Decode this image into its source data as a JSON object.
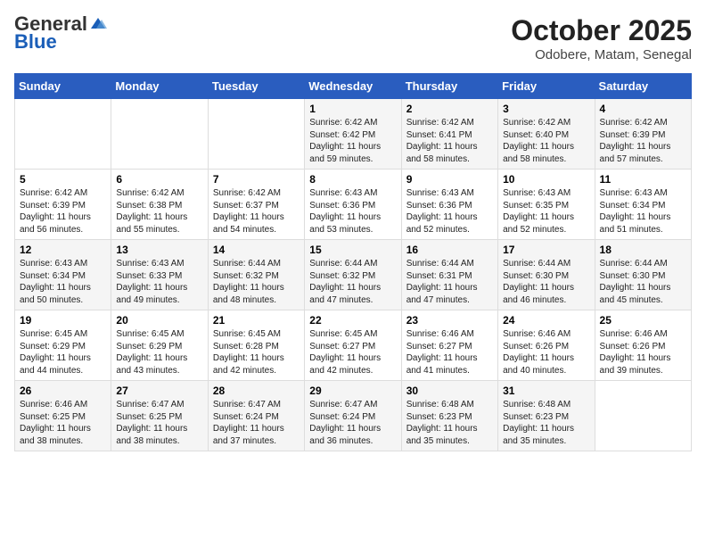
{
  "header": {
    "logo_general": "General",
    "logo_blue": "Blue",
    "month_title": "October 2025",
    "subtitle": "Odobere, Matam, Senegal"
  },
  "days_of_week": [
    "Sunday",
    "Monday",
    "Tuesday",
    "Wednesday",
    "Thursday",
    "Friday",
    "Saturday"
  ],
  "weeks": [
    [
      {
        "day": "",
        "sunrise": "",
        "sunset": "",
        "daylight": ""
      },
      {
        "day": "",
        "sunrise": "",
        "sunset": "",
        "daylight": ""
      },
      {
        "day": "",
        "sunrise": "",
        "sunset": "",
        "daylight": ""
      },
      {
        "day": "1",
        "sunrise": "Sunrise: 6:42 AM",
        "sunset": "Sunset: 6:42 PM",
        "daylight": "Daylight: 11 hours and 59 minutes."
      },
      {
        "day": "2",
        "sunrise": "Sunrise: 6:42 AM",
        "sunset": "Sunset: 6:41 PM",
        "daylight": "Daylight: 11 hours and 58 minutes."
      },
      {
        "day": "3",
        "sunrise": "Sunrise: 6:42 AM",
        "sunset": "Sunset: 6:40 PM",
        "daylight": "Daylight: 11 hours and 58 minutes."
      },
      {
        "day": "4",
        "sunrise": "Sunrise: 6:42 AM",
        "sunset": "Sunset: 6:39 PM",
        "daylight": "Daylight: 11 hours and 57 minutes."
      }
    ],
    [
      {
        "day": "5",
        "sunrise": "Sunrise: 6:42 AM",
        "sunset": "Sunset: 6:39 PM",
        "daylight": "Daylight: 11 hours and 56 minutes."
      },
      {
        "day": "6",
        "sunrise": "Sunrise: 6:42 AM",
        "sunset": "Sunset: 6:38 PM",
        "daylight": "Daylight: 11 hours and 55 minutes."
      },
      {
        "day": "7",
        "sunrise": "Sunrise: 6:42 AM",
        "sunset": "Sunset: 6:37 PM",
        "daylight": "Daylight: 11 hours and 54 minutes."
      },
      {
        "day": "8",
        "sunrise": "Sunrise: 6:43 AM",
        "sunset": "Sunset: 6:36 PM",
        "daylight": "Daylight: 11 hours and 53 minutes."
      },
      {
        "day": "9",
        "sunrise": "Sunrise: 6:43 AM",
        "sunset": "Sunset: 6:36 PM",
        "daylight": "Daylight: 11 hours and 52 minutes."
      },
      {
        "day": "10",
        "sunrise": "Sunrise: 6:43 AM",
        "sunset": "Sunset: 6:35 PM",
        "daylight": "Daylight: 11 hours and 52 minutes."
      },
      {
        "day": "11",
        "sunrise": "Sunrise: 6:43 AM",
        "sunset": "Sunset: 6:34 PM",
        "daylight": "Daylight: 11 hours and 51 minutes."
      }
    ],
    [
      {
        "day": "12",
        "sunrise": "Sunrise: 6:43 AM",
        "sunset": "Sunset: 6:34 PM",
        "daylight": "Daylight: 11 hours and 50 minutes."
      },
      {
        "day": "13",
        "sunrise": "Sunrise: 6:43 AM",
        "sunset": "Sunset: 6:33 PM",
        "daylight": "Daylight: 11 hours and 49 minutes."
      },
      {
        "day": "14",
        "sunrise": "Sunrise: 6:44 AM",
        "sunset": "Sunset: 6:32 PM",
        "daylight": "Daylight: 11 hours and 48 minutes."
      },
      {
        "day": "15",
        "sunrise": "Sunrise: 6:44 AM",
        "sunset": "Sunset: 6:32 PM",
        "daylight": "Daylight: 11 hours and 47 minutes."
      },
      {
        "day": "16",
        "sunrise": "Sunrise: 6:44 AM",
        "sunset": "Sunset: 6:31 PM",
        "daylight": "Daylight: 11 hours and 47 minutes."
      },
      {
        "day": "17",
        "sunrise": "Sunrise: 6:44 AM",
        "sunset": "Sunset: 6:30 PM",
        "daylight": "Daylight: 11 hours and 46 minutes."
      },
      {
        "day": "18",
        "sunrise": "Sunrise: 6:44 AM",
        "sunset": "Sunset: 6:30 PM",
        "daylight": "Daylight: 11 hours and 45 minutes."
      }
    ],
    [
      {
        "day": "19",
        "sunrise": "Sunrise: 6:45 AM",
        "sunset": "Sunset: 6:29 PM",
        "daylight": "Daylight: 11 hours and 44 minutes."
      },
      {
        "day": "20",
        "sunrise": "Sunrise: 6:45 AM",
        "sunset": "Sunset: 6:29 PM",
        "daylight": "Daylight: 11 hours and 43 minutes."
      },
      {
        "day": "21",
        "sunrise": "Sunrise: 6:45 AM",
        "sunset": "Sunset: 6:28 PM",
        "daylight": "Daylight: 11 hours and 42 minutes."
      },
      {
        "day": "22",
        "sunrise": "Sunrise: 6:45 AM",
        "sunset": "Sunset: 6:27 PM",
        "daylight": "Daylight: 11 hours and 42 minutes."
      },
      {
        "day": "23",
        "sunrise": "Sunrise: 6:46 AM",
        "sunset": "Sunset: 6:27 PM",
        "daylight": "Daylight: 11 hours and 41 minutes."
      },
      {
        "day": "24",
        "sunrise": "Sunrise: 6:46 AM",
        "sunset": "Sunset: 6:26 PM",
        "daylight": "Daylight: 11 hours and 40 minutes."
      },
      {
        "day": "25",
        "sunrise": "Sunrise: 6:46 AM",
        "sunset": "Sunset: 6:26 PM",
        "daylight": "Daylight: 11 hours and 39 minutes."
      }
    ],
    [
      {
        "day": "26",
        "sunrise": "Sunrise: 6:46 AM",
        "sunset": "Sunset: 6:25 PM",
        "daylight": "Daylight: 11 hours and 38 minutes."
      },
      {
        "day": "27",
        "sunrise": "Sunrise: 6:47 AM",
        "sunset": "Sunset: 6:25 PM",
        "daylight": "Daylight: 11 hours and 38 minutes."
      },
      {
        "day": "28",
        "sunrise": "Sunrise: 6:47 AM",
        "sunset": "Sunset: 6:24 PM",
        "daylight": "Daylight: 11 hours and 37 minutes."
      },
      {
        "day": "29",
        "sunrise": "Sunrise: 6:47 AM",
        "sunset": "Sunset: 6:24 PM",
        "daylight": "Daylight: 11 hours and 36 minutes."
      },
      {
        "day": "30",
        "sunrise": "Sunrise: 6:48 AM",
        "sunset": "Sunset: 6:23 PM",
        "daylight": "Daylight: 11 hours and 35 minutes."
      },
      {
        "day": "31",
        "sunrise": "Sunrise: 6:48 AM",
        "sunset": "Sunset: 6:23 PM",
        "daylight": "Daylight: 11 hours and 35 minutes."
      },
      {
        "day": "",
        "sunrise": "",
        "sunset": "",
        "daylight": ""
      }
    ]
  ]
}
